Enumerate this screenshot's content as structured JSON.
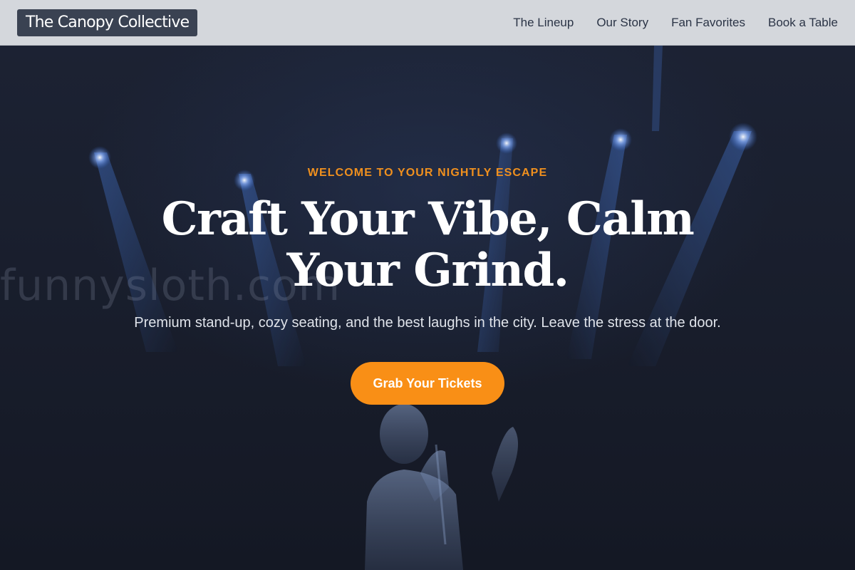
{
  "header": {
    "brand": "The Canopy Collective",
    "nav": [
      {
        "label": "The Lineup"
      },
      {
        "label": "Our Story"
      },
      {
        "label": "Fan Favorites"
      },
      {
        "label": "Book a Table"
      }
    ]
  },
  "hero": {
    "eyebrow": "WELCOME TO YOUR NIGHTLY ESCAPE",
    "headline_line1": "Craft Your Vibe, Calm",
    "headline_line2": "Your Grind.",
    "subtitle": "Premium stand-up, cozy seating, and the best laughs in the city. Leave the stress at the door.",
    "cta_label": "Grab Your Tickets",
    "watermark": "funnysloth.com"
  },
  "colors": {
    "accent": "#f98f16",
    "eyebrow": "#f0901e",
    "header_bg": "#d4d7dc",
    "brand_bg": "#3a4252",
    "hero_bg": "#171c2a",
    "spotlight": "#4a7fe0"
  }
}
